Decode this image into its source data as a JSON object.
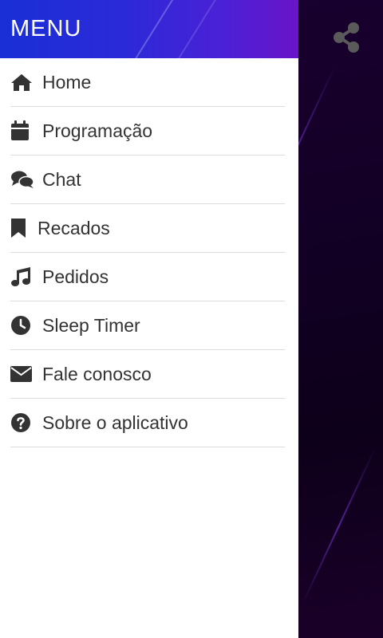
{
  "drawer": {
    "title": "MENU",
    "items": [
      {
        "label": "Home",
        "icon": "home-icon"
      },
      {
        "label": "Programação",
        "icon": "calendar-icon"
      },
      {
        "label": "Chat",
        "icon": "chat-icon"
      },
      {
        "label": "Recados",
        "icon": "bookmark-icon"
      },
      {
        "label": "Pedidos",
        "icon": "music-icon"
      },
      {
        "label": "Sleep Timer",
        "icon": "clock-icon"
      },
      {
        "label": "Fale conosco",
        "icon": "envelope-icon"
      },
      {
        "label": "Sobre o aplicativo",
        "icon": "question-circle-icon"
      }
    ]
  },
  "toolbar": {
    "share_icon": "share-icon"
  },
  "colors": {
    "header_start": "#1a2fd6",
    "header_end": "#6a14c8",
    "background": "#120024",
    "icon": "#333333",
    "text": "#333333"
  }
}
